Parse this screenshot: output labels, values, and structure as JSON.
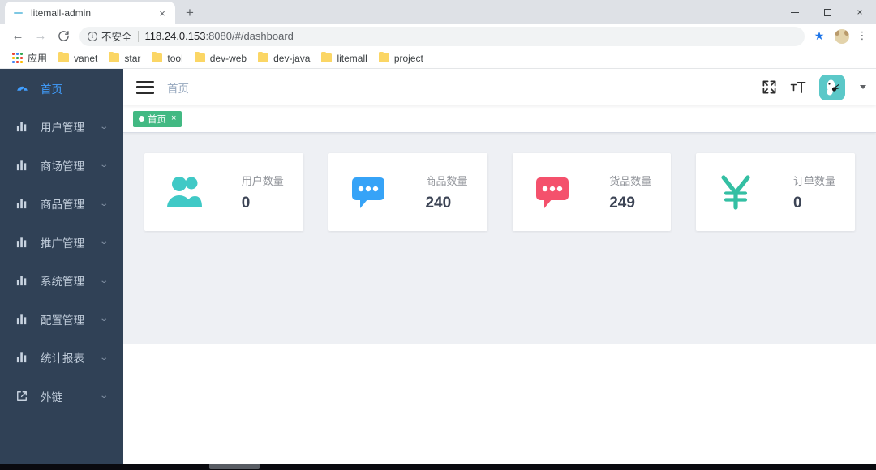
{
  "browser": {
    "tab": {
      "title": "litemall-admin",
      "close_label": "×",
      "favicon": "dash-favicon"
    },
    "newtab_label": "+",
    "window_controls": {
      "minimize": "−",
      "maximize": "□",
      "close": "×"
    },
    "nav": {
      "back": "←",
      "forward": "→",
      "reload": "↻"
    },
    "omnibox": {
      "info_glyph": "i",
      "security_label": "不安全",
      "url_host": "118.24.0.153",
      "url_rest": ":8080/#/dashboard",
      "star_glyph": "★",
      "menu_glyph": "⋮"
    },
    "bookmarks": {
      "apps_label": "应用",
      "items": [
        {
          "label": "vanet"
        },
        {
          "label": "star"
        },
        {
          "label": "tool"
        },
        {
          "label": "dev-web"
        },
        {
          "label": "dev-java"
        },
        {
          "label": "litemall"
        },
        {
          "label": "project"
        }
      ]
    }
  },
  "sidebar": {
    "items": [
      {
        "label": "首页",
        "icon": "dashboard-icon",
        "active": true,
        "has_arrow": false
      },
      {
        "label": "用户管理",
        "icon": "chart-bar-icon",
        "active": false,
        "has_arrow": true
      },
      {
        "label": "商场管理",
        "icon": "chart-bar-icon",
        "active": false,
        "has_arrow": true
      },
      {
        "label": "商品管理",
        "icon": "chart-bar-icon",
        "active": false,
        "has_arrow": true
      },
      {
        "label": "推广管理",
        "icon": "chart-bar-icon",
        "active": false,
        "has_arrow": true
      },
      {
        "label": "系统管理",
        "icon": "chart-bar-icon",
        "active": false,
        "has_arrow": true
      },
      {
        "label": "配置管理",
        "icon": "chart-bar-icon",
        "active": false,
        "has_arrow": true
      },
      {
        "label": "统计报表",
        "icon": "chart-bar-icon",
        "active": false,
        "has_arrow": true
      },
      {
        "label": "外链",
        "icon": "external-link-icon",
        "active": false,
        "has_arrow": true
      }
    ],
    "arrow_glyph": "⌄"
  },
  "navbar": {
    "breadcrumb": "首页",
    "fullscreen_icon": "fullscreen-icon",
    "fontsize_icon": "font-size-icon",
    "avatar_icon": "user-avatar"
  },
  "tags_view": {
    "tabs": [
      {
        "label": "首页",
        "close": "×",
        "active": true
      }
    ]
  },
  "dashboard": {
    "cards": [
      {
        "label": "用户数量",
        "value": "0",
        "icon": "people-icon",
        "color": "#40c9c6"
      },
      {
        "label": "商品数量",
        "value": "240",
        "icon": "message-icon",
        "color": "#36a3f7"
      },
      {
        "label": "货品数量",
        "value": "249",
        "icon": "message-icon",
        "color": "#f4516c"
      },
      {
        "label": "订单数量",
        "value": "0",
        "icon": "money-icon",
        "color": "#34bfa3"
      }
    ]
  },
  "taskbar": {
    "clock": ""
  },
  "colors": {
    "sidebar_bg": "#304156",
    "sidebar_active": "#409eff",
    "tag_green": "#42b983",
    "content_bg": "#eef0f4",
    "avatar_bg": "#5bc8c8"
  }
}
